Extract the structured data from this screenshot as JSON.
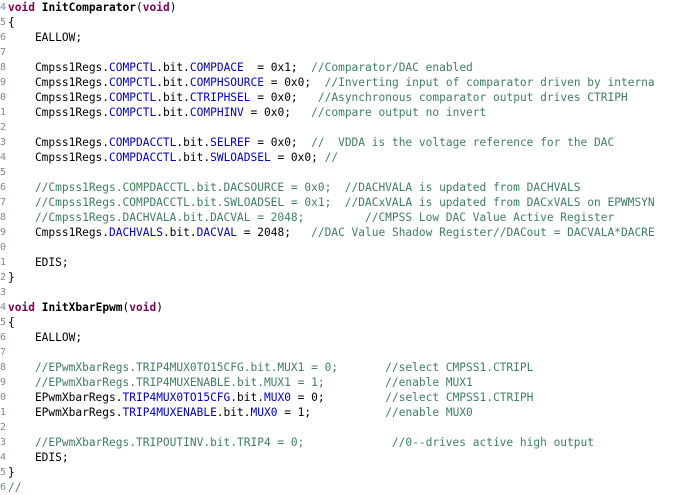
{
  "editor": {
    "lines": [
      {
        "n": "4",
        "segs": [
          {
            "c": "kw",
            "t": "void"
          },
          {
            "c": "pl",
            "t": " "
          },
          {
            "c": "fn",
            "t": "InitComparator"
          },
          {
            "c": "pl",
            "t": "("
          },
          {
            "c": "kw",
            "t": "void"
          },
          {
            "c": "pl",
            "t": ")"
          }
        ]
      },
      {
        "n": "5",
        "segs": [
          {
            "c": "pl",
            "t": "{"
          }
        ]
      },
      {
        "n": "6",
        "segs": [
          {
            "c": "pl",
            "t": "    EALLOW;"
          }
        ]
      },
      {
        "n": "7",
        "segs": []
      },
      {
        "n": "8",
        "segs": [
          {
            "c": "pl",
            "t": "    Cmpss1Regs."
          },
          {
            "c": "fld",
            "t": "COMPCTL"
          },
          {
            "c": "pl",
            "t": ".bit."
          },
          {
            "c": "fld",
            "t": "COMPDACE"
          },
          {
            "c": "pl",
            "t": "  = 0x1;  "
          },
          {
            "c": "cm",
            "t": "//Comparator/DAC enabled"
          }
        ]
      },
      {
        "n": "9",
        "segs": [
          {
            "c": "pl",
            "t": "    Cmpss1Regs."
          },
          {
            "c": "fld",
            "t": "COMPCTL"
          },
          {
            "c": "pl",
            "t": ".bit."
          },
          {
            "c": "fld",
            "t": "COMPHSOURCE"
          },
          {
            "c": "pl",
            "t": " = 0x0;  "
          },
          {
            "c": "cm",
            "t": "//Inverting input of comparator driven by interna"
          }
        ]
      },
      {
        "n": "0",
        "segs": [
          {
            "c": "pl",
            "t": "    Cmpss1Regs."
          },
          {
            "c": "fld",
            "t": "COMPCTL"
          },
          {
            "c": "pl",
            "t": ".bit."
          },
          {
            "c": "fld",
            "t": "CTRIPHSEL"
          },
          {
            "c": "pl",
            "t": " = 0x0;   "
          },
          {
            "c": "cm",
            "t": "//Asynchronous comparator output drives CTRIPH"
          }
        ]
      },
      {
        "n": "1",
        "segs": [
          {
            "c": "pl",
            "t": "    Cmpss1Regs."
          },
          {
            "c": "fld",
            "t": "COMPCTL"
          },
          {
            "c": "pl",
            "t": ".bit."
          },
          {
            "c": "fld",
            "t": "COMPHINV"
          },
          {
            "c": "pl",
            "t": " = 0x0;   "
          },
          {
            "c": "cm",
            "t": "//compare output no invert"
          }
        ]
      },
      {
        "n": "2",
        "segs": []
      },
      {
        "n": "3",
        "segs": [
          {
            "c": "pl",
            "t": "    Cmpss1Regs."
          },
          {
            "c": "fld",
            "t": "COMPDACCTL"
          },
          {
            "c": "pl",
            "t": ".bit."
          },
          {
            "c": "fld",
            "t": "SELREF"
          },
          {
            "c": "pl",
            "t": " = 0x0;  "
          },
          {
            "c": "cm",
            "t": "//  VDDA is the voltage reference for the DAC"
          }
        ]
      },
      {
        "n": "4",
        "segs": [
          {
            "c": "pl",
            "t": "    Cmpss1Regs."
          },
          {
            "c": "fld",
            "t": "COMPDACCTL"
          },
          {
            "c": "pl",
            "t": ".bit."
          },
          {
            "c": "fld",
            "t": "SWLOADSEL"
          },
          {
            "c": "pl",
            "t": " = 0x0; "
          },
          {
            "c": "cm",
            "t": "//"
          }
        ]
      },
      {
        "n": "5",
        "segs": []
      },
      {
        "n": "6",
        "segs": [
          {
            "c": "cm",
            "t": "    //Cmpss1Regs.COMPDACCTL.bit.DACSOURCE = 0x0;  //DACHVALA is updated from DACHVALS"
          }
        ]
      },
      {
        "n": "7",
        "segs": [
          {
            "c": "cm",
            "t": "    //Cmpss1Regs.COMPDACCTL.bit.SWLOADSEL = 0x1;  //DACxVALA is updated from DACxVALS on EPWMSYN"
          }
        ]
      },
      {
        "n": "8",
        "segs": [
          {
            "c": "cm",
            "t": "    //Cmpss1Regs.DACHVALA.bit.DACVAL = 2048;         //CMPSS Low DAC Value Active Register"
          }
        ]
      },
      {
        "n": "9",
        "segs": [
          {
            "c": "pl",
            "t": "    Cmpss1Regs."
          },
          {
            "c": "fld",
            "t": "DACHVALS"
          },
          {
            "c": "pl",
            "t": ".bit."
          },
          {
            "c": "fld",
            "t": "DACVAL"
          },
          {
            "c": "pl",
            "t": " = 2048;   "
          },
          {
            "c": "cm",
            "t": "//DAC Value Shadow Register//DACout = DACVALA*DACRE"
          }
        ]
      },
      {
        "n": "0",
        "segs": []
      },
      {
        "n": "1",
        "segs": [
          {
            "c": "pl",
            "t": "    EDIS;"
          }
        ]
      },
      {
        "n": "2",
        "segs": [
          {
            "c": "pl",
            "t": "}"
          }
        ]
      },
      {
        "n": "3",
        "segs": []
      },
      {
        "n": "4",
        "segs": [
          {
            "c": "kw",
            "t": "void"
          },
          {
            "c": "pl",
            "t": " "
          },
          {
            "c": "fn",
            "t": "InitXbarEpwm"
          },
          {
            "c": "pl",
            "t": "("
          },
          {
            "c": "kw",
            "t": "void"
          },
          {
            "c": "pl",
            "t": ")"
          }
        ]
      },
      {
        "n": "5",
        "segs": [
          {
            "c": "pl",
            "t": "{"
          }
        ]
      },
      {
        "n": "6",
        "segs": [
          {
            "c": "pl",
            "t": "    EALLOW;"
          }
        ]
      },
      {
        "n": "7",
        "segs": []
      },
      {
        "n": "8",
        "segs": [
          {
            "c": "cm",
            "t": "    //EPwmXbarRegs.TRIP4MUX0TO15CFG.bit.MUX1 = 0;       //select CMPSS1.CTRIPL"
          }
        ]
      },
      {
        "n": "9",
        "segs": [
          {
            "c": "cm",
            "t": "    //EPwmXbarRegs.TRIP4MUXENABLE.bit.MUX1 = 1;         //enable MUX1"
          }
        ]
      },
      {
        "n": "0",
        "segs": [
          {
            "c": "pl",
            "t": "    EPwmXbarRegs."
          },
          {
            "c": "fld",
            "t": "TRIP4MUX0TO15CFG"
          },
          {
            "c": "pl",
            "t": ".bit."
          },
          {
            "c": "fld",
            "t": "MUX0"
          },
          {
            "c": "pl",
            "t": " = 0;         "
          },
          {
            "c": "cm",
            "t": "//select CMPSS1.CTRIPH"
          }
        ]
      },
      {
        "n": "1",
        "segs": [
          {
            "c": "pl",
            "t": "    EPwmXbarRegs."
          },
          {
            "c": "fld",
            "t": "TRIP4MUXENABLE"
          },
          {
            "c": "pl",
            "t": ".bit."
          },
          {
            "c": "fld",
            "t": "MUX0"
          },
          {
            "c": "pl",
            "t": " = 1;           "
          },
          {
            "c": "cm",
            "t": "//enable MUX0"
          }
        ]
      },
      {
        "n": "2",
        "segs": []
      },
      {
        "n": "3",
        "segs": [
          {
            "c": "cm",
            "t": "    //EPwmXbarRegs.TRIPOUTINV.bit.TRIP4 = 0;             //0--drives active high output"
          }
        ]
      },
      {
        "n": "4",
        "segs": [
          {
            "c": "pl",
            "t": "    EDIS;"
          }
        ]
      },
      {
        "n": "5",
        "segs": [
          {
            "c": "pl",
            "t": "}"
          }
        ]
      },
      {
        "n": "6",
        "segs": [
          {
            "c": "cm",
            "t": "//"
          }
        ]
      }
    ]
  }
}
